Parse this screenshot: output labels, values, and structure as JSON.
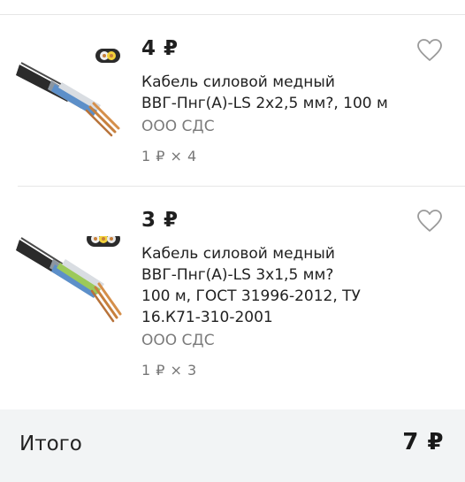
{
  "cart": {
    "items": [
      {
        "price": "4 ₽",
        "title_lines": [
          "Кабель силовой медный",
          "ВВГ-Пнг(А)-LS 2х2,5 мм?, 100 м"
        ],
        "seller": "ООО СДС",
        "quantity": "1 ₽ × 4",
        "icon": "heart-outline-icon"
      },
      {
        "price": "3 ₽",
        "title_lines": [
          "Кабель силовой медный",
          "ВВГ-Пнг(А)-LS 3х1,5 мм?",
          "100 м, ГОСТ 31996-2012, ТУ",
          "16.К71-310-2001"
        ],
        "seller": "ООО СДС",
        "quantity": "1 ₽ × 3",
        "icon": "heart-outline-icon"
      }
    ]
  },
  "summary": {
    "total_label": "Итого",
    "total_value": "7 ₽"
  },
  "colors": {
    "footer_bg": "#f2f4f5",
    "muted_text": "#7b7b7b",
    "divider": "#e6e6e6"
  }
}
